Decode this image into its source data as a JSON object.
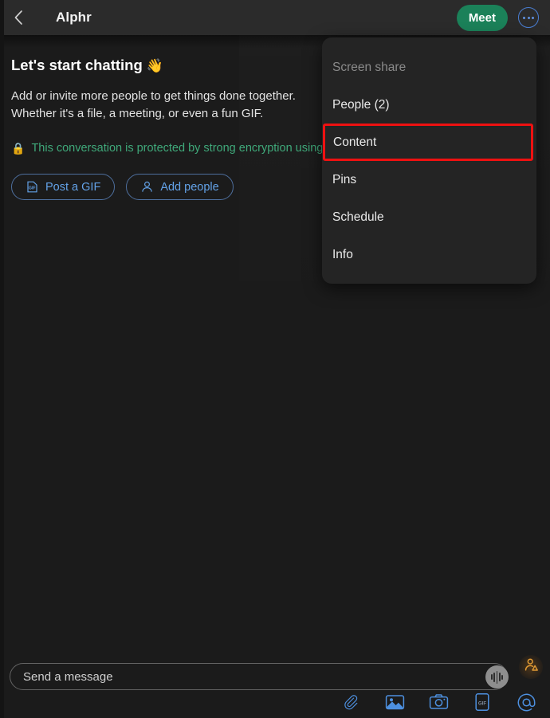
{
  "header": {
    "back_icon": "chevron-left-icon",
    "title": "Alphr",
    "meet_label": "Meet",
    "more_icon": "more-horizontal-icon",
    "meet_color": "#1b8159",
    "more_color": "#4a7fd4"
  },
  "intro": {
    "title": "Let's start chatting",
    "wave_emoji": "👋",
    "body": "Add or invite more people to get things done together. Whether it's a file, a meeting, or even a fun GIF.",
    "lock_emoji": "🔒",
    "encryption_text": "This conversation is protected by strong encryption using",
    "encryption_color": "#3fa97a",
    "buttons": [
      {
        "label": "Post a GIF",
        "icon": "gif-file-icon"
      },
      {
        "label": "Add people",
        "icon": "person-icon"
      }
    ]
  },
  "menu": {
    "items": [
      {
        "label": "Screen share",
        "state": "disabled",
        "highlighted": false
      },
      {
        "label": "People (2)",
        "state": "enabled",
        "highlighted": false
      },
      {
        "label": "Content",
        "state": "enabled",
        "highlighted": true
      },
      {
        "label": "Pins",
        "state": "enabled",
        "highlighted": false
      },
      {
        "label": "Schedule",
        "state": "enabled",
        "highlighted": false
      },
      {
        "label": "Info",
        "state": "enabled",
        "highlighted": false
      }
    ],
    "highlight_color": "#ee1111",
    "panel_color": "#242424"
  },
  "composer": {
    "placeholder": "Send a message",
    "input_value": "",
    "voice_icon": "voice-waveform-icon",
    "avatar_icon": "avatar-person-icon",
    "tools": [
      {
        "name": "attach-paperclip-icon"
      },
      {
        "name": "photo-image-icon"
      },
      {
        "name": "camera-icon"
      },
      {
        "name": "gif-icon"
      },
      {
        "name": "mention-at-icon"
      }
    ],
    "tool_color": "#4d90e0"
  }
}
